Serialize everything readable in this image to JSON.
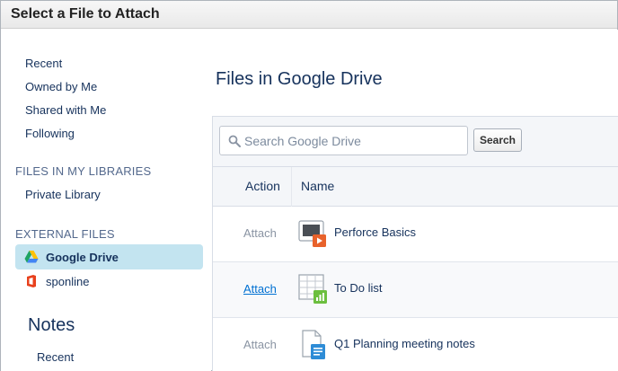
{
  "dialog": {
    "title": "Select a File to Attach"
  },
  "sidebar": {
    "items": [
      {
        "label": "Recent"
      },
      {
        "label": "Owned by Me"
      },
      {
        "label": "Shared with Me"
      },
      {
        "label": "Following"
      }
    ],
    "libraries_heading": "FILES IN MY LIBRARIES",
    "libraries": [
      {
        "label": "Private Library"
      }
    ],
    "external_heading": "EXTERNAL FILES",
    "external": [
      {
        "label": "Google Drive",
        "icon": "google-drive-icon",
        "selected": true
      },
      {
        "label": "sponline",
        "icon": "office-icon",
        "selected": false
      }
    ],
    "notes_heading": "Notes",
    "notes_items": [
      {
        "label": "Recent"
      }
    ]
  },
  "main": {
    "heading": "Files in Google Drive",
    "search": {
      "placeholder": "Search Google Drive",
      "value": "",
      "button_label": "Search"
    },
    "columns": {
      "action": "Action",
      "name": "Name"
    },
    "rows": [
      {
        "action": "Attach",
        "name": "Perforce Basics",
        "icon": "presentation-file-icon",
        "hovered": false
      },
      {
        "action": "Attach",
        "name": "To Do list",
        "icon": "spreadsheet-file-icon",
        "hovered": true
      },
      {
        "action": "Attach",
        "name": "Q1 Planning meeting notes",
        "icon": "document-file-icon",
        "hovered": false
      }
    ]
  },
  "colors": {
    "selected_bg": "#c3e4f0",
    "link": "#0070d2",
    "text": "#16325c",
    "muted": "#8a94a3"
  }
}
